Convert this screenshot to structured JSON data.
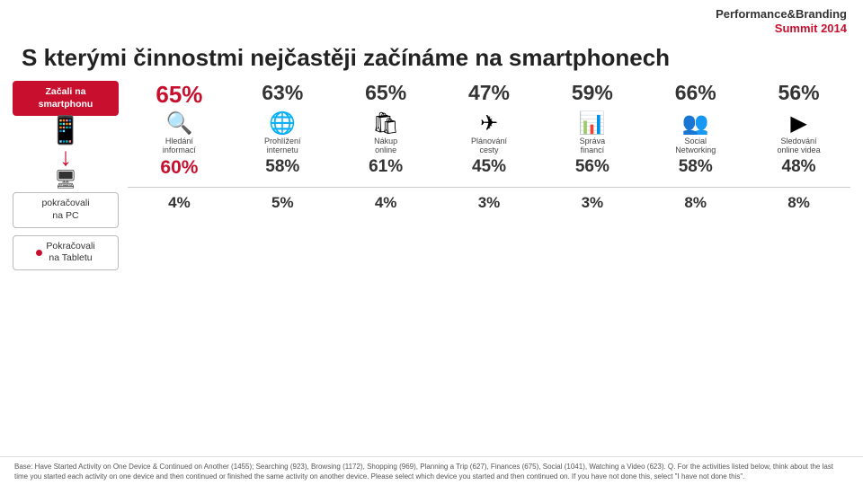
{
  "brand": {
    "line1": "Performance&Branding",
    "line2": "Summit 2014"
  },
  "title": "S kterými činnostmi nejčastěji začínáme na smartphonech",
  "labels": {
    "smartphone": "Začali na\nsmartphonu",
    "pc": "pokračovali\nna PC",
    "tablet": "Pokračovali\nna Tabletu"
  },
  "columns": [
    {
      "icon": "🔍",
      "label": "Hledání\ninformací"
    },
    {
      "icon": "🌐",
      "label": "Prohlížení\ninternetu"
    },
    {
      "icon": "🛍",
      "label": "Nákup\nonline"
    },
    {
      "icon": "✈",
      "label": "Plánování\ncesty"
    },
    {
      "icon": "📊",
      "label": "Správa\nfinancí"
    },
    {
      "icon": "👥",
      "label": "Social\nNetworking"
    },
    {
      "icon": "▶",
      "label": "Sledování\nonline videa"
    }
  ],
  "smartphone_row": [
    "65%",
    "63%",
    "65%",
    "47%",
    "59%",
    "66%",
    "56%"
  ],
  "smartphone_highlight": 0,
  "pc_row": [
    "60%",
    "58%",
    "61%",
    "45%",
    "56%",
    "58%",
    "48%"
  ],
  "pc_highlight": 0,
  "tablet_row": [
    "4%",
    "5%",
    "4%",
    "3%",
    "3%",
    "8%",
    "8%"
  ],
  "tablet_highlight": -1,
  "footer": "Base: Have Started Activity on One Device & Continued on Another (1455); Searching (923), Browsing (1172), Shopping (969), Planning a Trip (627), Finances (675), Social (1041), Watching a Video (623). Q. For the activities listed below, think about the last time you started each activity on one device and then continued or finished the same activity on another device. Please select which device you started and then continued on. If you have not done this, select \"I have not done this\"."
}
